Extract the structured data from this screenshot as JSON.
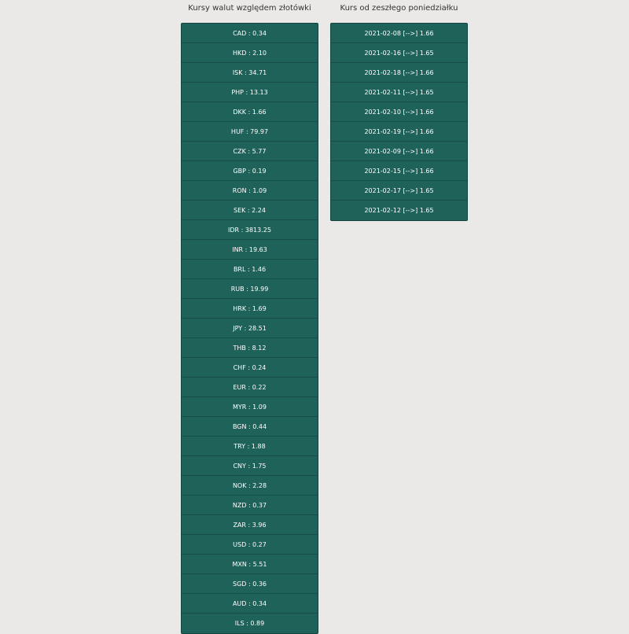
{
  "columns": {
    "rates": {
      "title": "Kursy walut względem złotówki",
      "items": [
        "CAD : 0.34",
        "HKD : 2.10",
        "ISK : 34.71",
        "PHP : 13.13",
        "DKK : 1.66",
        "HUF : 79.97",
        "CZK : 5.77",
        "GBP : 0.19",
        "RON : 1.09",
        "SEK : 2.24",
        "IDR : 3813.25",
        "INR : 19.63",
        "BRL : 1.46",
        "RUB : 19.99",
        "HRK : 1.69",
        "JPY : 28.51",
        "THB : 8.12",
        "CHF : 0.24",
        "EUR : 0.22",
        "MYR : 1.09",
        "BGN : 0.44",
        "TRY : 1.88",
        "CNY : 1.75",
        "NOK : 2.28",
        "NZD : 0.37",
        "ZAR : 3.96",
        "USD : 0.27",
        "MXN : 5.51",
        "SGD : 0.36",
        "AUD : 0.34",
        "ILS : 0.89"
      ]
    },
    "history": {
      "title": "Kurs od zeszłego poniedziałku",
      "items": [
        "2021-02-08 [-->] 1.66",
        "2021-02-16 [-->] 1.65",
        "2021-02-18 [-->] 1.66",
        "2021-02-11 [-->] 1.65",
        "2021-02-10 [-->] 1.66",
        "2021-02-19 [-->] 1.66",
        "2021-02-09 [-->] 1.66",
        "2021-02-15 [-->] 1.66",
        "2021-02-17 [-->] 1.65",
        "2021-02-12 [-->] 1.65"
      ]
    }
  },
  "colors": {
    "background": "#ebe9e7",
    "row_background": "#1e625a",
    "row_text": "#ffffff"
  }
}
